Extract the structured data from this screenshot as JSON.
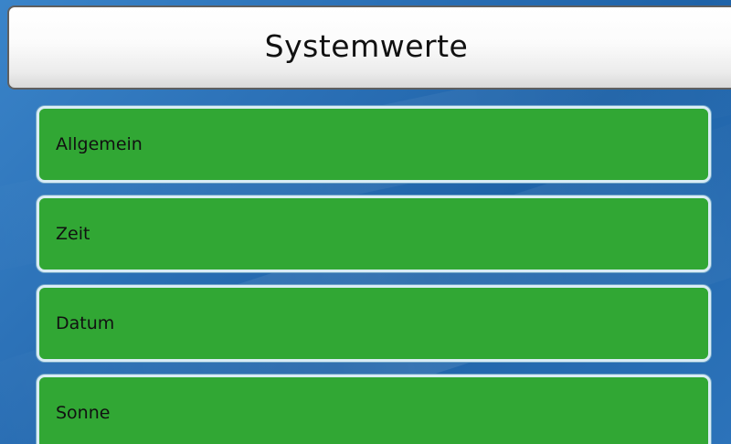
{
  "header": {
    "title": "Systemwerte"
  },
  "menu": {
    "items": [
      {
        "label": "Allgemein"
      },
      {
        "label": "Zeit"
      },
      {
        "label": "Datum"
      },
      {
        "label": "Sonne"
      }
    ]
  },
  "colors": {
    "background": "#2a6fb5",
    "item_fill": "#31a734",
    "item_border": "#d9ecf5",
    "header_fill": "#f4f4f4"
  }
}
